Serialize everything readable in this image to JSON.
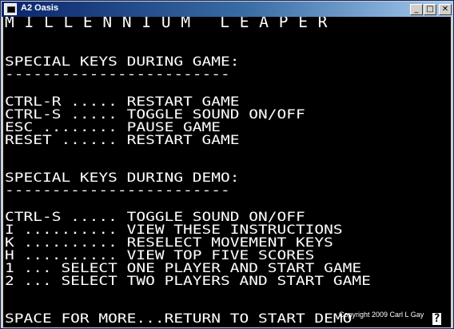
{
  "window": {
    "title": "A2 Oasis",
    "minimize_glyph": "_",
    "maximize_glyph": "□",
    "close_glyph": "✕",
    "icon": "apple-ii-monitor-icon"
  },
  "screen": {
    "header": "M I L L E N N I U M   L E A P E R",
    "game_section": {
      "title": "SPECIAL KEYS DURING GAME:",
      "underline": "------------------------",
      "lines": [
        "CTRL-R ..... RESTART GAME",
        "CTRL-S ..... TOGGLE SOUND ON/OFF",
        "ESC ........ PAUSE GAME",
        "RESET ...... RESTART GAME"
      ]
    },
    "demo_section": {
      "title": "SPECIAL KEYS DURING DEMO:",
      "underline": "------------------------",
      "lines": [
        "CTRL-S ..... TOGGLE SOUND ON/OFF",
        "I .......... VIEW THESE INSTRUCTIONS",
        "K .......... RESELECT MOVEMENT KEYS",
        "H .......... VIEW TOP FIVE SCORES",
        "1 ... SELECT ONE PLAYER AND START GAME",
        "2 ... SELECT TWO PLAYERS AND START GAME"
      ]
    },
    "footer": "SPACE FOR MORE...RETURN TO START DEMO",
    "copyright": "Copyright 2009 Carl L Gay",
    "cursor_glyph": "?"
  },
  "colors": {
    "screen_background": "#000000",
    "screen_text": "#ffffff",
    "titlebar_start": "#0a246a",
    "titlebar_end": "#a6caf0"
  }
}
